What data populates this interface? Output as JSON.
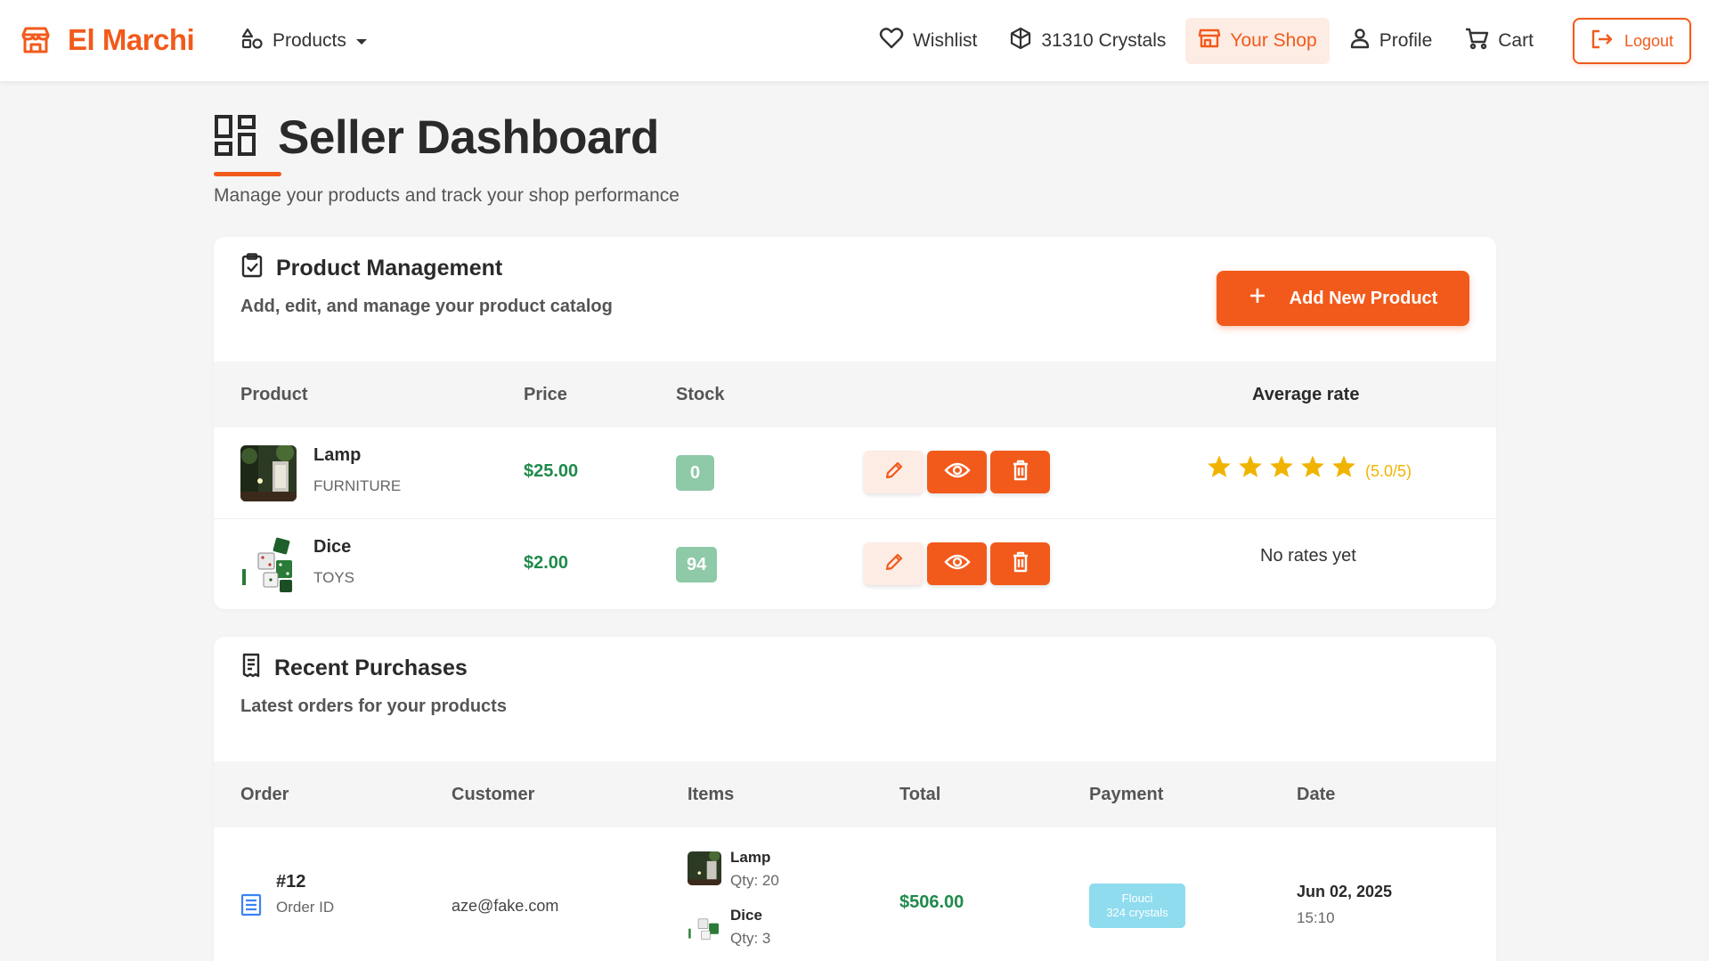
{
  "nav": {
    "brand": "El Marchi",
    "products_label": "Products",
    "wishlist_label": "Wishlist",
    "crystals_label": "31310 Crystals",
    "shop_label": "Your Shop",
    "profile_label": "Profile",
    "cart_label": "Cart",
    "logout_label": "Logout"
  },
  "header": {
    "title": "Seller Dashboard",
    "subtitle": "Manage your products and track your shop performance"
  },
  "product_management": {
    "title": "Product Management",
    "description": "Add, edit, and manage your product catalog",
    "add_button": "Add New Product",
    "columns": [
      "Product",
      "Price",
      "Stock",
      "Average rate"
    ],
    "rows": [
      {
        "name": "Lamp",
        "category": "FURNITURE",
        "price": "$25.00",
        "stock": "0",
        "rating_stars": 5,
        "rating_text": "(5.0/5)"
      },
      {
        "name": "Dice",
        "category": "TOYS",
        "price": "$2.00",
        "stock": "94",
        "rating_text": "No rates yet"
      }
    ]
  },
  "recent_purchases": {
    "title": "Recent Purchases",
    "description": "Latest orders for your products",
    "columns": [
      "Order",
      "Customer",
      "Items",
      "Total",
      "Payment",
      "Date"
    ],
    "orders": [
      {
        "id": "#12",
        "id_label": "Order ID",
        "customer": "aze@fake.com",
        "items": [
          {
            "name": "Lamp",
            "qty": "Qty: 20"
          },
          {
            "name": "Dice",
            "qty": "Qty: 3"
          }
        ],
        "total": "$506.00",
        "payment_method": "Flouci",
        "payment_detail": "324 crystals",
        "date": "Jun 02, 2025",
        "time": "15:10"
      }
    ]
  },
  "colors": {
    "brand": "#f25a1b",
    "price_green": "#1f8a4c",
    "stock_badge": "#8ec9a8",
    "star": "#f0b400",
    "payment_badge": "#8fdcef"
  }
}
